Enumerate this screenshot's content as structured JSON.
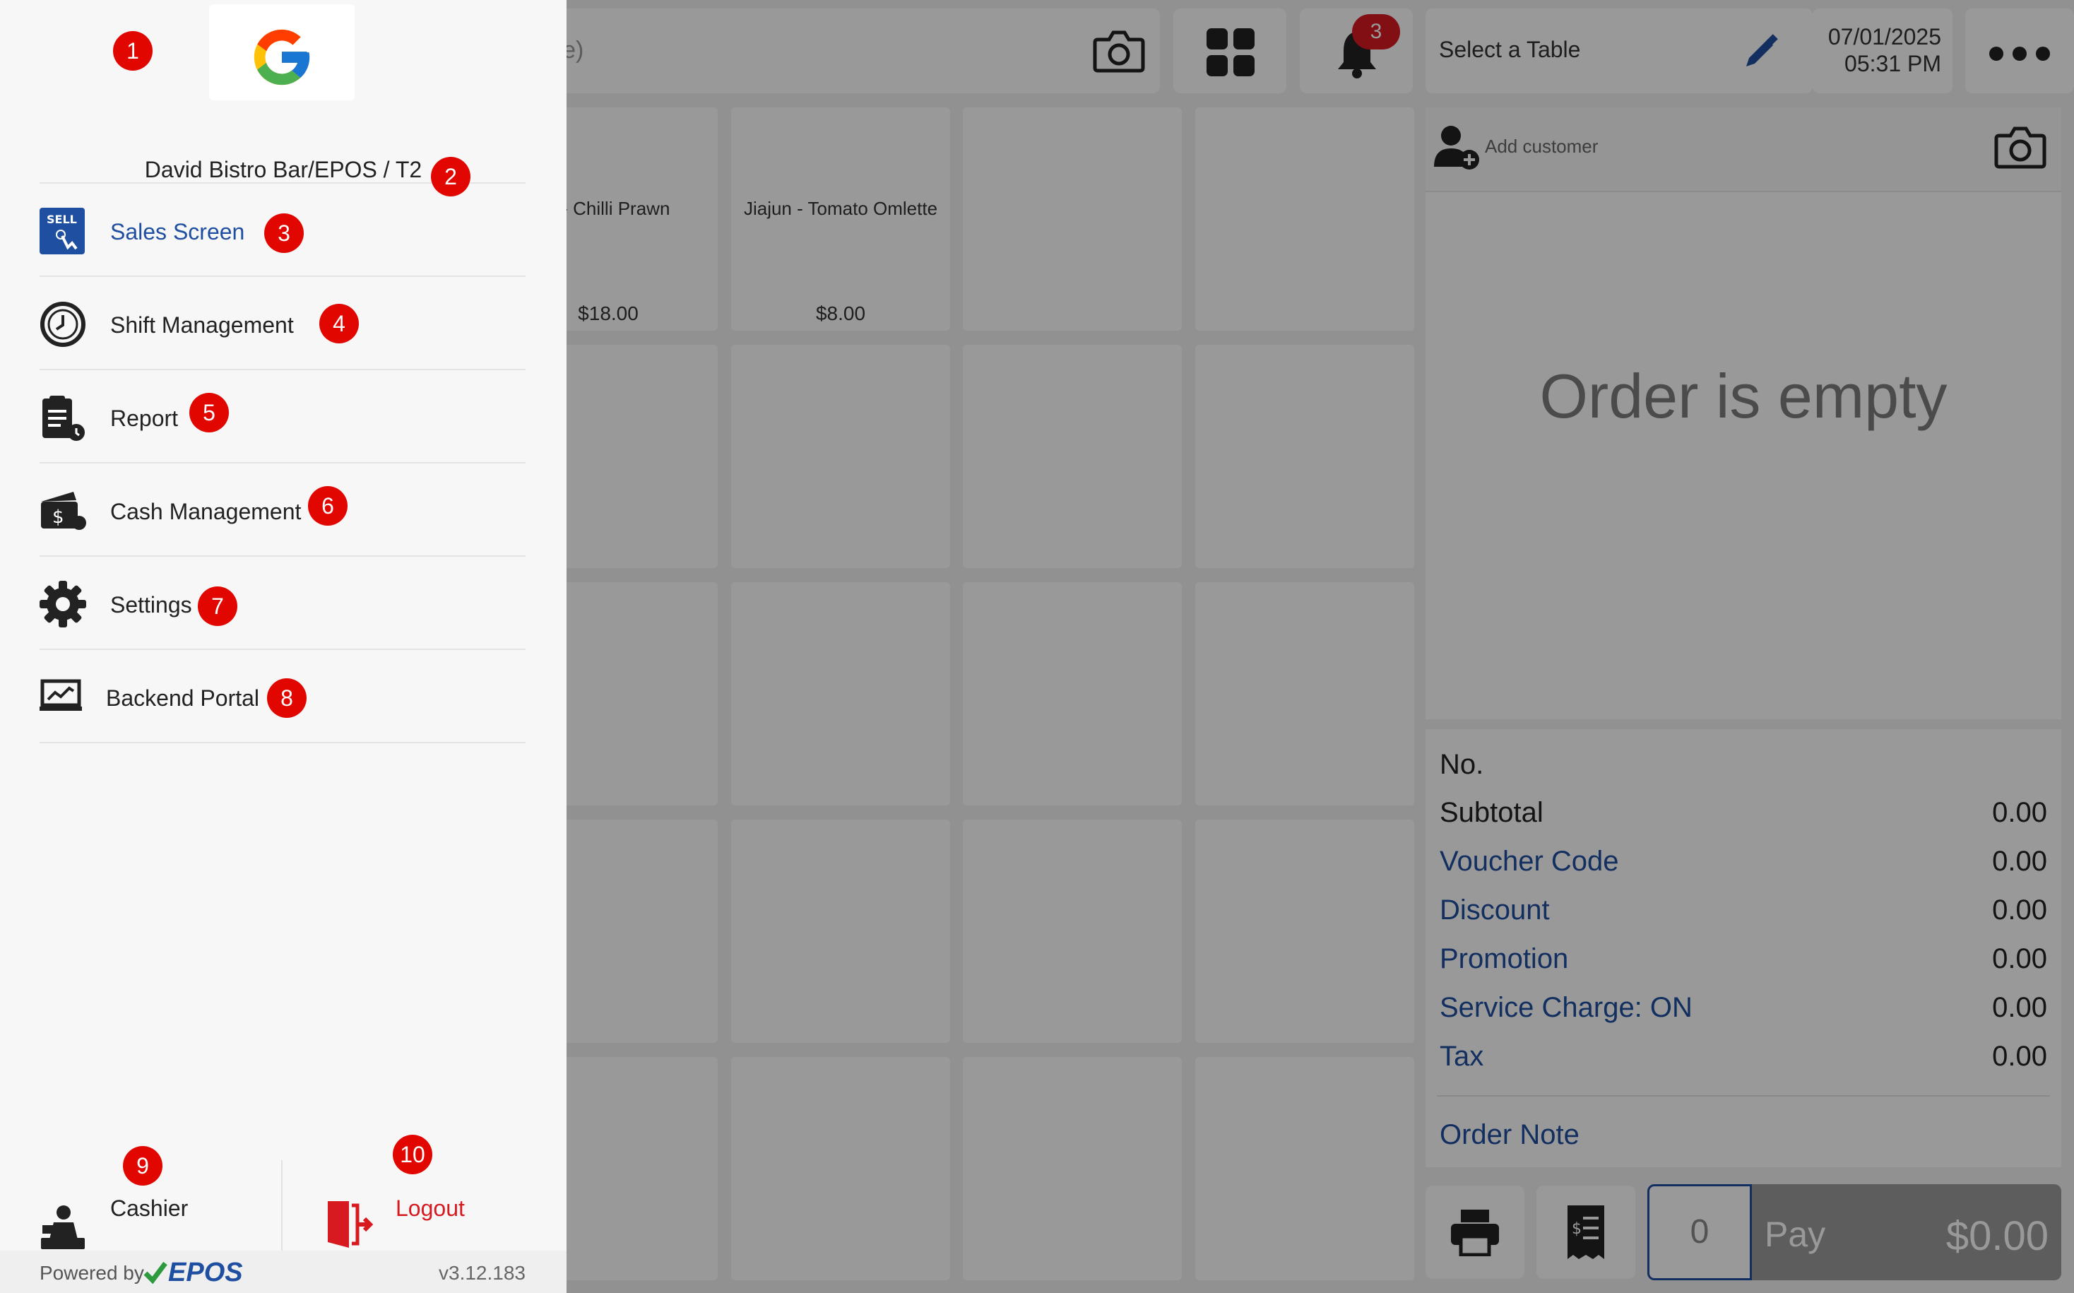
{
  "pos": {
    "search_placeholder": "rcode)",
    "table_label": "Select a Table",
    "date": "07/01/2025",
    "time": "05:31 PM",
    "notification_count": "3",
    "products": [
      {
        "name": "n - Chilli Prawn",
        "price": "$18.00"
      },
      {
        "name": "Jiajun - Tomato Omlette",
        "price": "$8.00"
      }
    ],
    "add_customer": "Add customer",
    "order_empty": "Order is empty",
    "summary": {
      "no_label": "No.",
      "rows": [
        {
          "label": "Subtotal",
          "value": "0.00"
        },
        {
          "label": "Voucher Code",
          "value": "0.00"
        },
        {
          "label": "Discount",
          "value": "0.00"
        },
        {
          "label": "Promotion",
          "value": "0.00"
        },
        {
          "label": "Service Charge: ON",
          "value": "0.00"
        },
        {
          "label": "Tax",
          "value": "0.00"
        }
      ],
      "order_note": "Order Note"
    },
    "quantity": "0",
    "pay_label": "Pay",
    "pay_amount": "$0.00",
    "colors": {
      "accent": "#1f4fa0",
      "badge": "#d71920"
    }
  },
  "drawer": {
    "store_name": "David Bistro Bar/EPOS / T2",
    "menu": [
      {
        "label": "Sales Screen",
        "icon": "sell-icon"
      },
      {
        "label": "Shift Management",
        "icon": "clock-icon"
      },
      {
        "label": "Report",
        "icon": "report-icon"
      },
      {
        "label": "Cash Management",
        "icon": "cash-icon"
      },
      {
        "label": "Settings",
        "icon": "gear-icon"
      },
      {
        "label": "Backend Portal",
        "icon": "monitor-chart-icon"
      }
    ],
    "cashier_label": "Cashier",
    "logout_label": "Logout",
    "powered_by": "Powered by",
    "brand": "EPOS",
    "version": "v3.12.183"
  },
  "markers": [
    "1",
    "2",
    "3",
    "4",
    "5",
    "6",
    "7",
    "8",
    "9",
    "10"
  ]
}
